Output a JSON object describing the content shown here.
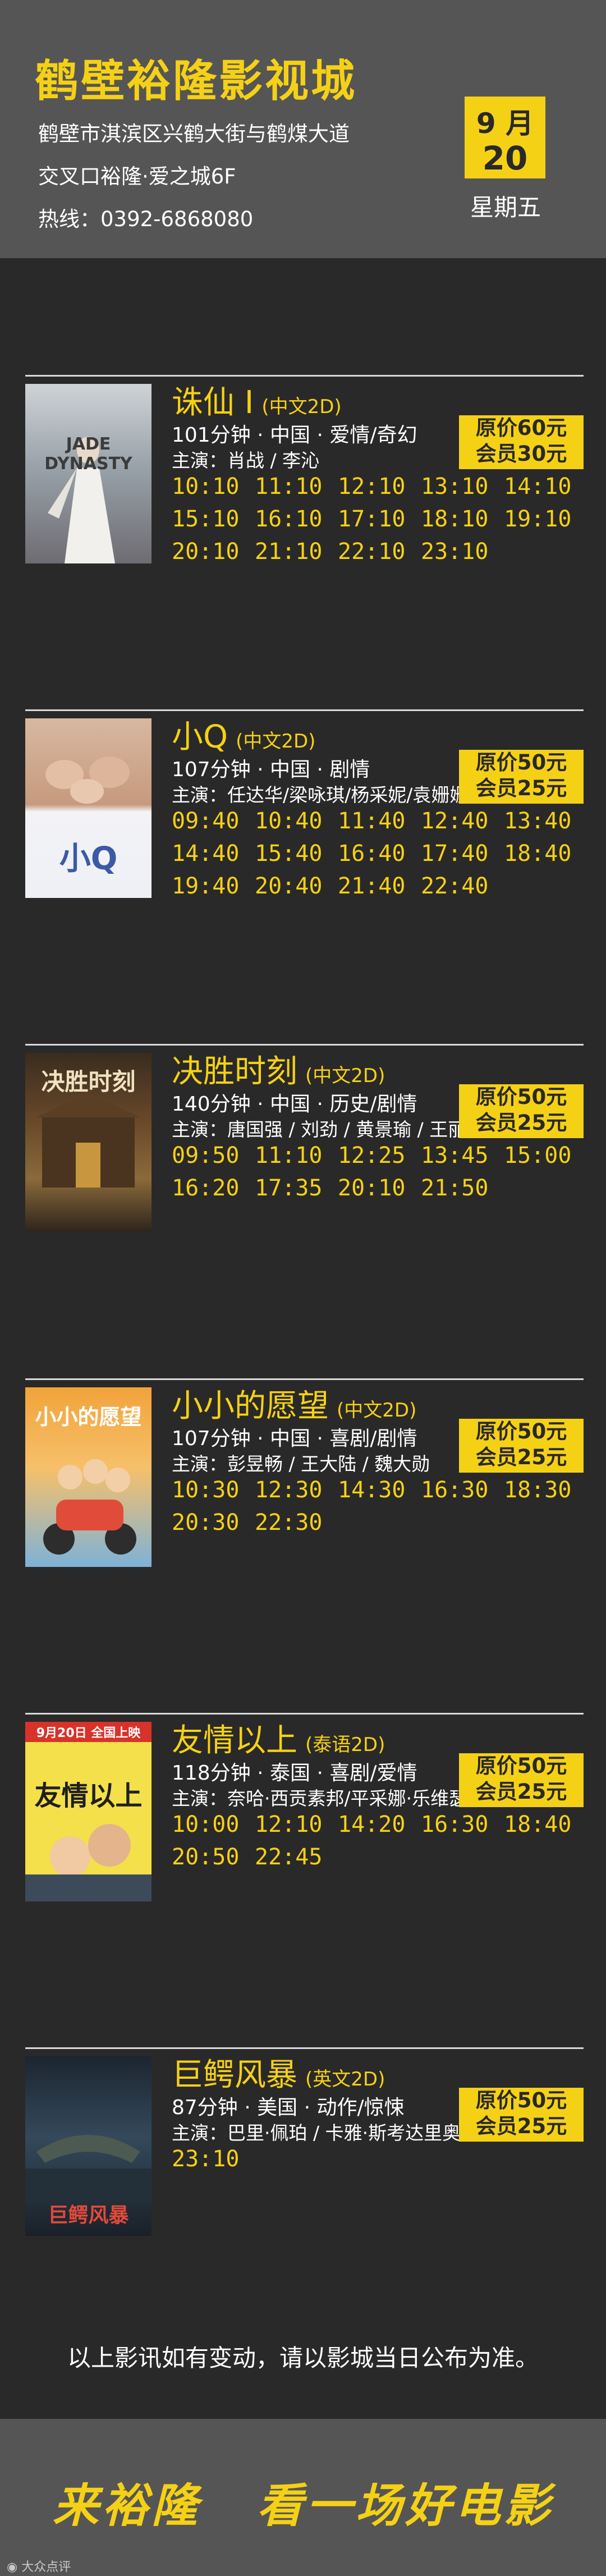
{
  "header": {
    "cinema_name": "鹤壁裕隆影视城",
    "address_line1": "鹤壁市淇滨区兴鹤大街与鹤煤大道",
    "address_line2": "交叉口裕隆·爱之城6F",
    "hotline": "热线：0392-6868080",
    "date_month": "9 月",
    "date_day": "20",
    "weekday": "星期五",
    "accent_color": "#f5d116"
  },
  "movies": [
    {
      "title": "诛仙 I",
      "lang": "(中文2D)",
      "info": "101分钟 · 中国 · 爱情/奇幻",
      "cast": "主演：肖战 / 李沁",
      "price_original": "原价60元",
      "price_member": "会员30元",
      "poster_text": "JADE DYNASTY",
      "times": [
        "10:10",
        "11:10",
        "12:10",
        "13:10",
        "14:10",
        "15:10",
        "16:10",
        "17:10",
        "18:10",
        "19:10",
        "20:10",
        "21:10",
        "22:10",
        "23:10"
      ]
    },
    {
      "title": "小Q",
      "lang": "(中文2D)",
      "info": "107分钟 · 中国 · 剧情",
      "cast": "主演：任达华/梁咏琪/杨采妮/袁姗姗",
      "price_original": "原价50元",
      "price_member": "会员25元",
      "poster_text": "小Q",
      "times": [
        "09:40",
        "10:40",
        "11:40",
        "12:40",
        "13:40",
        "14:40",
        "15:40",
        "16:40",
        "17:40",
        "18:40",
        "19:40",
        "20:40",
        "21:40",
        "22:40"
      ]
    },
    {
      "title": "决胜时刻",
      "lang": "(中文2D)",
      "info": "140分钟 · 中国 · 历史/剧情",
      "cast": "主演：唐国强 / 刘劲 / 黄景瑜 / 王丽坤",
      "price_original": "原价50元",
      "price_member": "会员25元",
      "poster_text": "决胜时刻",
      "times": [
        "09:50",
        "11:10",
        "12:25",
        "13:45",
        "15:00",
        "16:20",
        "17:35",
        "20:10",
        "21:50"
      ]
    },
    {
      "title": "小小的愿望",
      "lang": "(中文2D)",
      "info": "107分钟 · 中国 · 喜剧/剧情",
      "cast": "主演：彭昱畅 / 王大陆 / 魏大勋",
      "price_original": "原价50元",
      "price_member": "会员25元",
      "poster_text": "小小的愿望",
      "times": [
        "10:30",
        "12:30",
        "14:30",
        "16:30",
        "18:30",
        "20:30",
        "22:30"
      ]
    },
    {
      "title": "友情以上",
      "lang": "(泰语2D)",
      "info": "118分钟 · 泰国 · 喜剧/爱情",
      "cast": "主演：奈哈·西贡素邦/平采娜·乐维瑟派布恩",
      "price_original": "原价50元",
      "price_member": "会员25元",
      "poster_text": "友情以上",
      "poster_banner": "9月20日 全国上映",
      "times": [
        "10:00",
        "12:10",
        "14:20",
        "16:30",
        "18:40",
        "20:50",
        "22:45"
      ]
    },
    {
      "title": "巨鳄风暴",
      "lang": "(英文2D)",
      "info": "87分钟 · 美国 · 动作/惊悚",
      "cast": "主演：巴里·佩珀 / 卡雅·斯考达里奥",
      "price_original": "原价50元",
      "price_member": "会员25元",
      "poster_text": "巨鳄风暴",
      "times": [
        "23:10"
      ]
    }
  ],
  "notice": "以上影讯如有变动，请以影城当日公布为准。",
  "footer": {
    "slogan_left": "来裕隆",
    "slogan_right": "看一场好电影",
    "watermark": "大众点评"
  }
}
